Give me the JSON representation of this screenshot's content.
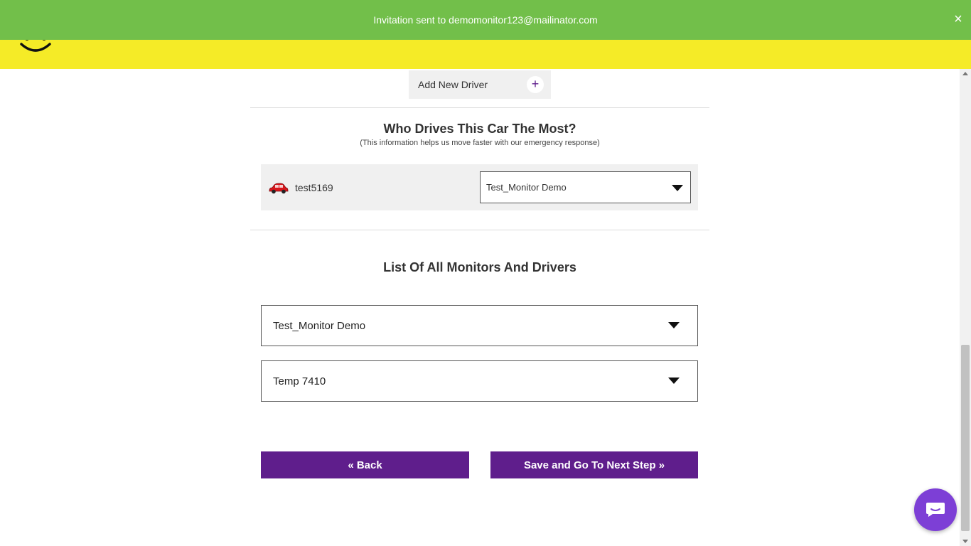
{
  "notification": {
    "message": "Invitation sent to demomonitor123@mailinator.com",
    "close_label": "×"
  },
  "add_driver": {
    "label": "Add New Driver",
    "icon": "plus-icon",
    "plus_symbol": "+"
  },
  "who_drives": {
    "title": "Who Drives This Car The Most?",
    "subtitle": "(This information helps us move faster with our emergency response)",
    "car": {
      "icon": "car-icon",
      "name": "test5169",
      "selected_driver": "Test_Monitor Demo"
    }
  },
  "list_section": {
    "title": "List Of All Monitors And Drivers",
    "items": [
      {
        "label": "Test_Monitor Demo"
      },
      {
        "label": "Temp 7410"
      }
    ]
  },
  "buttons": {
    "back": "« Back",
    "next": "Save and Go To Next Step »"
  },
  "colors": {
    "header_yellow": "#f5eb27",
    "notification_green": "#72bf4a",
    "button_purple": "#5f1e8c",
    "chat_purple": "#7d3fd6"
  }
}
